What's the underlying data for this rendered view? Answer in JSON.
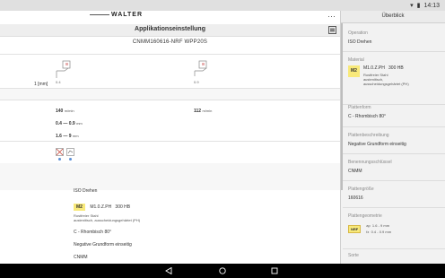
{
  "status_bar": {
    "time": "14:13"
  },
  "header": {
    "logo_text": "WALTER",
    "title": "Applikationseinstellung",
    "subtitle": "CNMM160616-NRF WPP20S"
  },
  "tools": {
    "left_label": "0.4",
    "right_label": "0.9",
    "depth_label": "1 [mm]"
  },
  "cutting_data": {
    "speed_left": "140",
    "speed_right": "112",
    "speed_unit": "m/min",
    "feed_range": "0.4 — 0.9",
    "feed_unit": "mm",
    "depth_range": "1.6 — 9",
    "depth_unit": "mm"
  },
  "details": {
    "operation": "ISO Drehen",
    "material_badge": "M2",
    "material_code": "M1.0.Z.PH",
    "material_hardness": "300 HB",
    "material_desc_1": "Rostfreier Stahl",
    "material_desc_2": "austenitisch, ausscheidungsgehärtet (PH)",
    "plate_shape": "C - Rhombisch 80°",
    "plate_desc": "Negative Grundform einseitig",
    "designation": "CNMM"
  },
  "panel": {
    "title": "Überblick",
    "sections": [
      {
        "label": "Operation",
        "value": "ISO Drehen"
      },
      {
        "label": "Material",
        "badge": "M2",
        "code": "M1.0.Z.PH",
        "hardness": "300 HB",
        "desc_1": "Rostfreier Stahl",
        "desc_2": "austenitisch,",
        "desc_3": "ausscheidungsgehärtet (PH)"
      },
      {
        "label": "Plattenform",
        "value": "C - Rhombisch 80°"
      },
      {
        "label": "Plattenbeschreibung",
        "value": "Negative Grundform einseitig"
      },
      {
        "label": "Benennungsschlüssel",
        "value": "CNMM"
      },
      {
        "label": "Plattengröße",
        "value": "160616"
      },
      {
        "label": "Plattengeometrie",
        "badge": "NRF",
        "ap_label": "ap",
        "ap_value": "1.6 - 9 mm",
        "f_label": "fz",
        "f_value": "0.4 - 0.9 mm"
      },
      {
        "label": "Sorte"
      }
    ]
  }
}
